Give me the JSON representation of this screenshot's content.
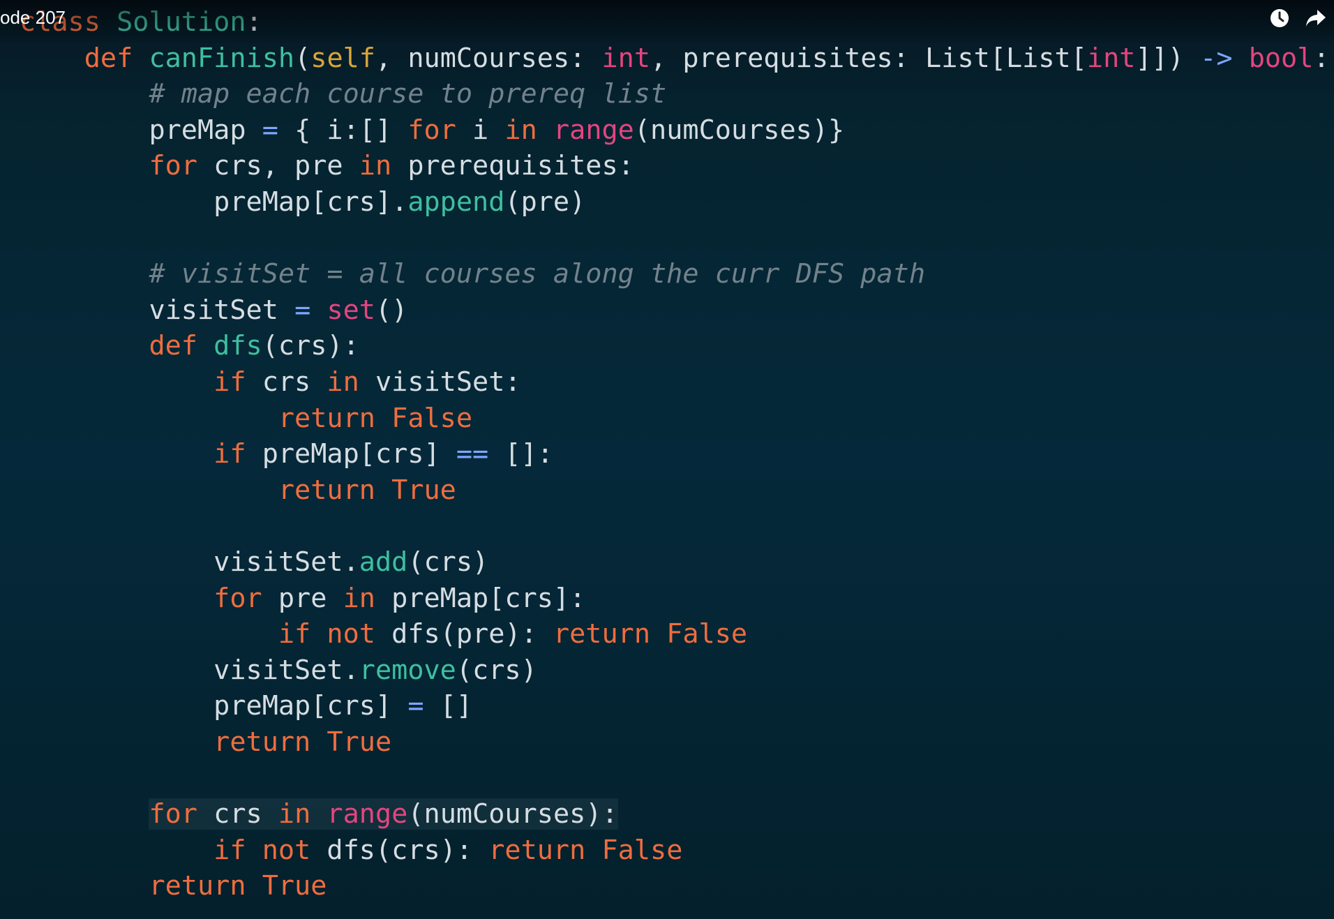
{
  "video": {
    "title": "ode 207",
    "watch_later_icon": "clock-icon",
    "share_icon": "share-arrow-icon"
  },
  "palette": {
    "background": "#05293a",
    "keyword": "#ef6d3e",
    "function": "#3fbfa0",
    "self": "#d9a53a",
    "builtin": "#e4457f",
    "comment": "#72828c",
    "operator": "#7ea6ff",
    "text": "#d6dde2"
  },
  "editor": {
    "language": "python",
    "lines": [
      {
        "indent": 0,
        "tokens": [
          {
            "t": "class",
            "c": "kw"
          },
          {
            "t": " ",
            "c": "pn"
          },
          {
            "t": "Solution",
            "c": "clsname"
          },
          {
            "t": ":",
            "c": "pn"
          }
        ]
      },
      {
        "indent": 1,
        "tokens": [
          {
            "t": "def",
            "c": "kw"
          },
          {
            "t": " ",
            "c": "pn"
          },
          {
            "t": "canFinish",
            "c": "fn"
          },
          {
            "t": "(",
            "c": "pn"
          },
          {
            "t": "self",
            "c": "slf"
          },
          {
            "t": ", numCourses: ",
            "c": "pn"
          },
          {
            "t": "int",
            "c": "bi"
          },
          {
            "t": ", prerequisites: List[List[",
            "c": "pn"
          },
          {
            "t": "int",
            "c": "bi"
          },
          {
            "t": "]]) ",
            "c": "pn"
          },
          {
            "t": "->",
            "c": "op"
          },
          {
            "t": " ",
            "c": "pn"
          },
          {
            "t": "bool",
            "c": "bi"
          },
          {
            "t": ":",
            "c": "pn"
          }
        ]
      },
      {
        "indent": 2,
        "tokens": [
          {
            "t": "# map each course to prereq list",
            "c": "cm"
          }
        ]
      },
      {
        "indent": 2,
        "tokens": [
          {
            "t": "preMap ",
            "c": "id"
          },
          {
            "t": "=",
            "c": "op"
          },
          {
            "t": " { i:[] ",
            "c": "pn"
          },
          {
            "t": "for",
            "c": "kw"
          },
          {
            "t": " i ",
            "c": "id"
          },
          {
            "t": "in",
            "c": "kw"
          },
          {
            "t": " ",
            "c": "pn"
          },
          {
            "t": "range",
            "c": "bi"
          },
          {
            "t": "(numCourses)}",
            "c": "pn"
          }
        ]
      },
      {
        "indent": 2,
        "tokens": [
          {
            "t": "for",
            "c": "kw"
          },
          {
            "t": " crs, pre ",
            "c": "id"
          },
          {
            "t": "in",
            "c": "kw"
          },
          {
            "t": " prerequisites:",
            "c": "id"
          }
        ]
      },
      {
        "indent": 3,
        "tokens": [
          {
            "t": "preMap[crs].",
            "c": "id"
          },
          {
            "t": "append",
            "c": "fn"
          },
          {
            "t": "(pre)",
            "c": "pn"
          }
        ]
      },
      {
        "indent": 0,
        "tokens": []
      },
      {
        "indent": 2,
        "tokens": [
          {
            "t": "# visitSet = all courses along the curr DFS path",
            "c": "cm"
          }
        ]
      },
      {
        "indent": 2,
        "tokens": [
          {
            "t": "visitSet ",
            "c": "id"
          },
          {
            "t": "=",
            "c": "op"
          },
          {
            "t": " ",
            "c": "pn"
          },
          {
            "t": "set",
            "c": "bi"
          },
          {
            "t": "()",
            "c": "pn"
          }
        ]
      },
      {
        "indent": 2,
        "tokens": [
          {
            "t": "def",
            "c": "kw"
          },
          {
            "t": " ",
            "c": "pn"
          },
          {
            "t": "dfs",
            "c": "fn"
          },
          {
            "t": "(crs):",
            "c": "pn"
          }
        ]
      },
      {
        "indent": 3,
        "tokens": [
          {
            "t": "if",
            "c": "kw"
          },
          {
            "t": " crs ",
            "c": "id"
          },
          {
            "t": "in",
            "c": "kw"
          },
          {
            "t": " visitSet:",
            "c": "id"
          }
        ]
      },
      {
        "indent": 4,
        "tokens": [
          {
            "t": "return",
            "c": "kw"
          },
          {
            "t": " ",
            "c": "pn"
          },
          {
            "t": "False",
            "c": "kw"
          }
        ]
      },
      {
        "indent": 3,
        "tokens": [
          {
            "t": "if",
            "c": "kw"
          },
          {
            "t": " preMap[crs] ",
            "c": "id"
          },
          {
            "t": "==",
            "c": "op"
          },
          {
            "t": " []:",
            "c": "pn"
          }
        ]
      },
      {
        "indent": 4,
        "tokens": [
          {
            "t": "return",
            "c": "kw"
          },
          {
            "t": " ",
            "c": "pn"
          },
          {
            "t": "True",
            "c": "kw"
          }
        ]
      },
      {
        "indent": 0,
        "tokens": []
      },
      {
        "indent": 3,
        "tokens": [
          {
            "t": "visitSet.",
            "c": "id"
          },
          {
            "t": "add",
            "c": "fn"
          },
          {
            "t": "(crs)",
            "c": "pn"
          }
        ]
      },
      {
        "indent": 3,
        "tokens": [
          {
            "t": "for",
            "c": "kw"
          },
          {
            "t": " pre ",
            "c": "id"
          },
          {
            "t": "in",
            "c": "kw"
          },
          {
            "t": " preMap[crs]:",
            "c": "id"
          }
        ]
      },
      {
        "indent": 4,
        "tokens": [
          {
            "t": "if",
            "c": "kw"
          },
          {
            "t": " ",
            "c": "pn"
          },
          {
            "t": "not",
            "c": "kw"
          },
          {
            "t": " dfs(pre): ",
            "c": "id"
          },
          {
            "t": "return",
            "c": "kw"
          },
          {
            "t": " ",
            "c": "pn"
          },
          {
            "t": "False",
            "c": "kw"
          }
        ]
      },
      {
        "indent": 3,
        "tokens": [
          {
            "t": "visitSet.",
            "c": "id"
          },
          {
            "t": "remove",
            "c": "fn"
          },
          {
            "t": "(crs)",
            "c": "pn"
          }
        ]
      },
      {
        "indent": 3,
        "tokens": [
          {
            "t": "preMap[crs] ",
            "c": "id"
          },
          {
            "t": "=",
            "c": "op"
          },
          {
            "t": " []",
            "c": "pn"
          }
        ]
      },
      {
        "indent": 3,
        "tokens": [
          {
            "t": "return",
            "c": "kw"
          },
          {
            "t": " ",
            "c": "pn"
          },
          {
            "t": "True",
            "c": "kw"
          }
        ]
      },
      {
        "indent": 0,
        "tokens": []
      },
      {
        "indent": 2,
        "highlight": true,
        "tokens": [
          {
            "t": "for",
            "c": "kw"
          },
          {
            "t": " crs ",
            "c": "id"
          },
          {
            "t": "in",
            "c": "kw"
          },
          {
            "t": " ",
            "c": "pn"
          },
          {
            "t": "range",
            "c": "bi"
          },
          {
            "t": "(numCourses):",
            "c": "pn"
          }
        ]
      },
      {
        "indent": 3,
        "tokens": [
          {
            "t": "if",
            "c": "kw"
          },
          {
            "t": " ",
            "c": "pn"
          },
          {
            "t": "not",
            "c": "kw"
          },
          {
            "t": " dfs(crs): ",
            "c": "id"
          },
          {
            "t": "return",
            "c": "kw"
          },
          {
            "t": " ",
            "c": "pn"
          },
          {
            "t": "False",
            "c": "kw"
          }
        ]
      },
      {
        "indent": 2,
        "tokens": [
          {
            "t": "return",
            "c": "kw"
          },
          {
            "t": " ",
            "c": "pn"
          },
          {
            "t": "True",
            "c": "kw"
          }
        ]
      }
    ]
  }
}
